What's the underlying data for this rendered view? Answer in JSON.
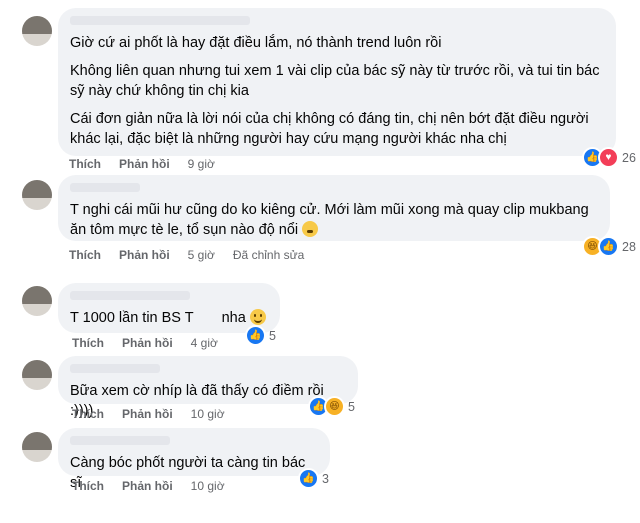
{
  "colors": {
    "bubble": "#f0f2f5",
    "meta": "#65676b",
    "like": "#1877f2",
    "love": "#f33e58",
    "haha": "#f7b125"
  },
  "actions": {
    "like_label": "Thích",
    "reply_label": "Phản hồi",
    "edited_label": "Đã chỉnh sửa"
  },
  "comments": [
    {
      "paragraphs": [
        "Giờ cứ ai phốt là hay đặt điều lắm, nó thành trend luôn rồi",
        "Không liên quan nhưng tui xem 1 vài clip của bác sỹ này từ trước rồi, và tui tin bác sỹ này chứ không tin chị kia",
        "Cái đơn giản nữa là lời nói của chị không có đáng tin, chị nên bớt đặt điều người khác lại, đặc biệt là những người hay cứu mạng người khác nha chị"
      ],
      "time": "9 giờ",
      "reaction_count": "26",
      "reactions": [
        "like-icon",
        "love-icon"
      ]
    },
    {
      "paragraphs": [
        "T nghi cái mũi hư cũng do ko kiêng cử. Mới làm mũi xong mà quay clip mukbang ăn tôm mực tè le, tổ sụn nào độ nổi"
      ],
      "time": "5 giờ",
      "reaction_count": "28",
      "reactions": [
        "haha-icon",
        "like-icon"
      ]
    },
    {
      "text_before": "T 1000 lần tin BS T",
      "text_after": "nha",
      "time": "4 giờ",
      "reaction_count": "5",
      "reactions": [
        "like-icon"
      ]
    },
    {
      "text": "Bữa xem cờ nhíp là đã thấy có điềm rồi :))))",
      "time": "10 giờ",
      "reaction_count": "5",
      "reactions": [
        "like-icon",
        "haha-icon"
      ]
    },
    {
      "text": "Càng bóc phốt người ta càng tin bác sĩ",
      "time": "10 giờ",
      "reaction_count": "3",
      "reactions": [
        "like-icon"
      ]
    }
  ]
}
